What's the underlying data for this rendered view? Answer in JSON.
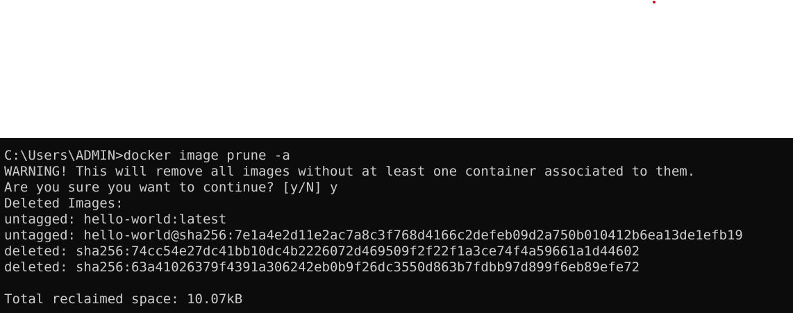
{
  "colors": {
    "terminal_background": "#0c0c0c",
    "terminal_text": "#cccccc",
    "page_background": "#ffffff",
    "dot": "#c8102e"
  },
  "terminal": {
    "lines": [
      "C:\\Users\\ADMIN>docker image prune -a",
      "WARNING! This will remove all images without at least one container associated to them.",
      "Are you sure you want to continue? [y/N] y",
      "Deleted Images:",
      "untagged: hello-world:latest",
      "untagged: hello-world@sha256:7e1a4e2d11e2ac7a8c3f768d4166c2defeb09d2a750b010412b6ea13de1efb19",
      "deleted: sha256:74cc54e27dc41bb10dc4b2226072d469509f2f22f1a3ce74f4a59661a1d44602",
      "deleted: sha256:63a41026379f4391a306242eb0b9f26dc3550d863b7fdbb97d899f6eb89efe72",
      "",
      "Total reclaimed space: 10.07kB"
    ]
  }
}
